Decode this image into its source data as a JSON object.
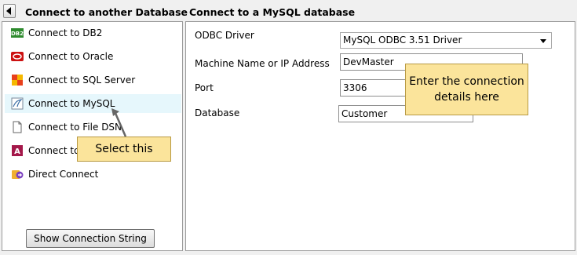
{
  "header": {
    "left_title": "Connect to another Database",
    "right_title": "Connect to a MySQL database"
  },
  "sidebar": {
    "items": [
      {
        "label": "Connect to DB2",
        "icon": "db2-icon"
      },
      {
        "label": "Connect to Oracle",
        "icon": "oracle-icon"
      },
      {
        "label": "Connect to SQL Server",
        "icon": "sql-server-icon"
      },
      {
        "label": "Connect to MySQL",
        "icon": "mysql-icon",
        "selected": true
      },
      {
        "label": "Connect to File DSN",
        "icon": "file-icon"
      },
      {
        "label": "Connect to",
        "icon": "access-icon"
      },
      {
        "label": "Direct Connect",
        "icon": "direct-connect-icon"
      }
    ],
    "show_connection_string_label": "Show Connection String"
  },
  "form": {
    "odbc_driver_label": "ODBC Driver",
    "odbc_driver_value": "MySQL ODBC 3.51 Driver",
    "machine_label": "Machine Name or IP Address",
    "machine_value": "DevMaster",
    "port_label": "Port",
    "port_value": "3306",
    "database_label": "Database",
    "database_value": "Customer"
  },
  "callouts": {
    "select_this": "Select this",
    "enter_details_line1": "Enter the connection",
    "enter_details_line2": "details here"
  },
  "colors": {
    "selected_row": "#e6f7fc",
    "callout_fill": "#fbe49b",
    "callout_border": "#b89a44"
  }
}
